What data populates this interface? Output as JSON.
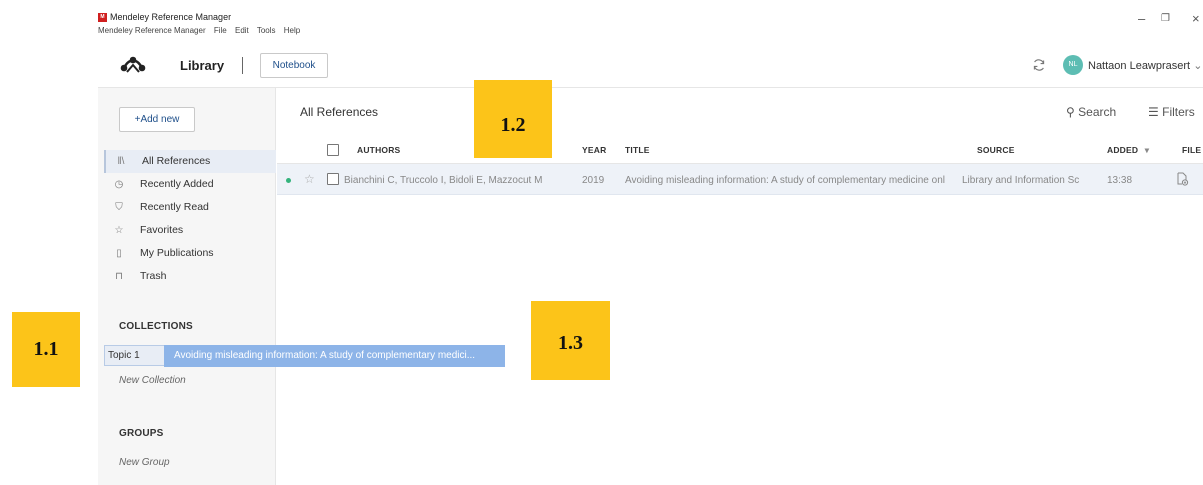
{
  "window": {
    "app_logo_text": "M",
    "title": "Mendeley Reference Manager",
    "menu": [
      "Mendeley Reference Manager",
      "File",
      "Edit",
      "Tools",
      "Help"
    ],
    "minimize": "–",
    "restore": "❐",
    "close": "×"
  },
  "header": {
    "section_title": "Library",
    "notebook_button": "Notebook",
    "user_initials": "NL",
    "user_name": "Nattaon Leawprasert",
    "chevron": "⌄"
  },
  "sidebar": {
    "add_new_label": "+Add new",
    "nav": [
      {
        "label": "All References",
        "icon": "library-icon"
      },
      {
        "label": "Recently Added",
        "icon": "clock-icon"
      },
      {
        "label": "Recently Read",
        "icon": "bookmark-icon"
      },
      {
        "label": "Favorites",
        "icon": "star-icon"
      },
      {
        "label": "My Publications",
        "icon": "publications-icon"
      },
      {
        "label": "Trash",
        "icon": "trash-icon"
      }
    ],
    "collections_heading": "COLLECTIONS",
    "collections": [
      {
        "label": "Topic 1"
      }
    ],
    "new_collection_label": "New Collection",
    "groups_heading": "GROUPS",
    "new_group_label": "New Group"
  },
  "main": {
    "title": "All References",
    "search_label": "Search",
    "filters_label": "Filters",
    "columns": {
      "authors": "AUTHORS",
      "year": "YEAR",
      "title": "TITLE",
      "source": "SOURCE",
      "added": "ADDED",
      "file": "FILE"
    },
    "sort_indicator": "▾",
    "rows": [
      {
        "authors": "Bianchini C, Truccolo I, Bidoli E, Mazzocut M",
        "year": "2019",
        "title": "Avoiding misleading information: A study of complementary medicine onl",
        "source": "Library and Information Sc",
        "added": "13:38"
      }
    ]
  },
  "drag_ghost": {
    "text": "Avoiding misleading information: A study of complementary medici..."
  },
  "callouts": [
    "1.1",
    "1.2",
    "1.3"
  ],
  "colors": {
    "callout": "#fcc419",
    "drag_ghost": "#8db4e8",
    "avatar": "#5dbdb3",
    "accent_text": "#1e4f8a",
    "unread_dot": "#34b37c"
  }
}
